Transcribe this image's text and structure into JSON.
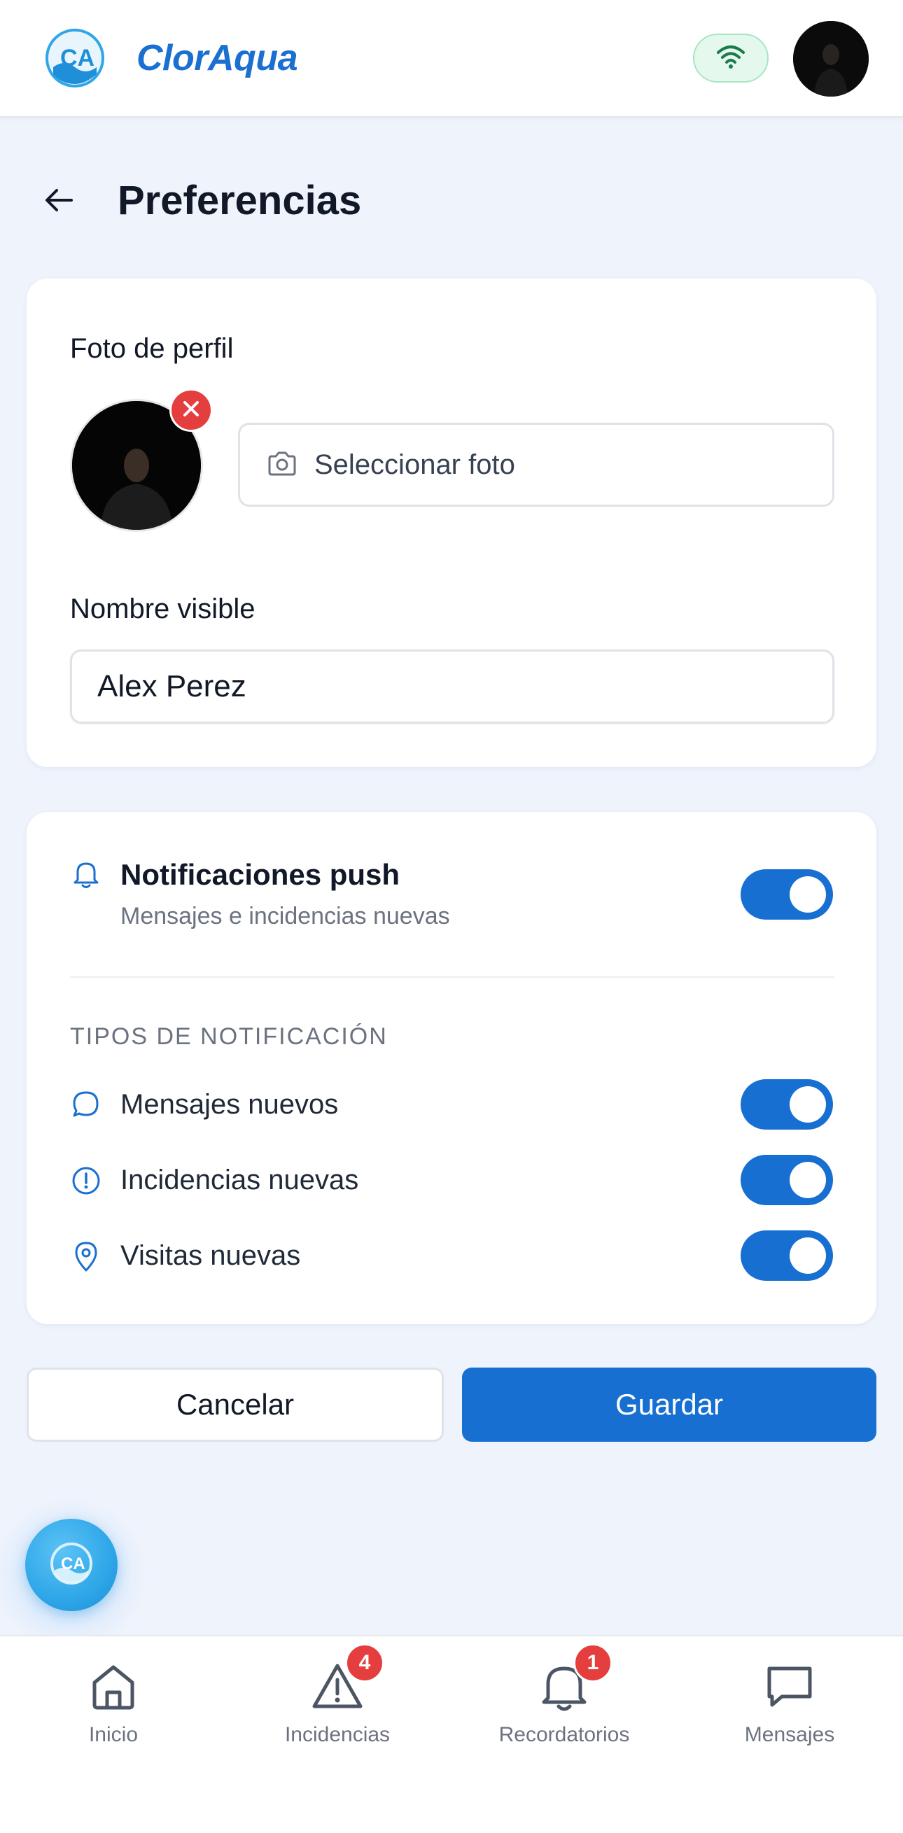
{
  "header": {
    "brand": "ClorAqua",
    "logo_icon": "cloraqua-logo",
    "status_icon": "wifi-icon",
    "colors": {
      "brand": "#1a6fd0",
      "status_bg": "#e4f8ee"
    }
  },
  "page": {
    "title": "Preferencias",
    "back_icon": "arrow-left-icon"
  },
  "profile_card": {
    "photo_label": "Foto de perfil",
    "select_photo_label": "Seleccionar foto",
    "name_label": "Nombre visible",
    "name_value": "Alex Perez"
  },
  "notifications_card": {
    "push_title": "Notificaciones push",
    "push_subtitle": "Mensajes e incidencias nuevas",
    "push_enabled": true,
    "section_heading": "TIPOS DE NOTIFICACIÓN",
    "types": [
      {
        "label": "Mensajes nuevos",
        "icon": "message-circle-icon",
        "enabled": true
      },
      {
        "label": "Incidencias nuevas",
        "icon": "alert-circle-icon",
        "enabled": true
      },
      {
        "label": "Visitas nuevas",
        "icon": "map-pin-icon",
        "enabled": true
      }
    ]
  },
  "actions": {
    "cancel_label": "Cancelar",
    "save_label": "Guardar",
    "accent": "#176fd1"
  },
  "bottom_nav": {
    "items": [
      {
        "label": "Inicio",
        "icon": "home-icon",
        "badge": ""
      },
      {
        "label": "Incidencias",
        "icon": "warning-triangle-icon",
        "badge": "4"
      },
      {
        "label": "Recordatorios",
        "icon": "bell-icon",
        "badge": "1"
      },
      {
        "label": "Mensajes",
        "icon": "message-square-icon",
        "badge": ""
      }
    ]
  }
}
